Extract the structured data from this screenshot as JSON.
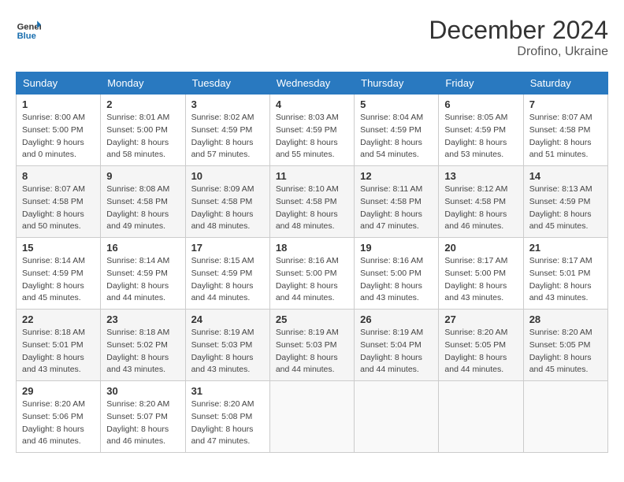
{
  "header": {
    "logo_line1": "General",
    "logo_line2": "Blue",
    "month_title": "December 2024",
    "location": "Drofino, Ukraine"
  },
  "calendar": {
    "days_of_week": [
      "Sunday",
      "Monday",
      "Tuesday",
      "Wednesday",
      "Thursday",
      "Friday",
      "Saturday"
    ],
    "weeks": [
      [
        {
          "day": "1",
          "info": "Sunrise: 8:00 AM\nSunset: 5:00 PM\nDaylight: 9 hours\nand 0 minutes."
        },
        {
          "day": "2",
          "info": "Sunrise: 8:01 AM\nSunset: 5:00 PM\nDaylight: 8 hours\nand 58 minutes."
        },
        {
          "day": "3",
          "info": "Sunrise: 8:02 AM\nSunset: 4:59 PM\nDaylight: 8 hours\nand 57 minutes."
        },
        {
          "day": "4",
          "info": "Sunrise: 8:03 AM\nSunset: 4:59 PM\nDaylight: 8 hours\nand 55 minutes."
        },
        {
          "day": "5",
          "info": "Sunrise: 8:04 AM\nSunset: 4:59 PM\nDaylight: 8 hours\nand 54 minutes."
        },
        {
          "day": "6",
          "info": "Sunrise: 8:05 AM\nSunset: 4:59 PM\nDaylight: 8 hours\nand 53 minutes."
        },
        {
          "day": "7",
          "info": "Sunrise: 8:07 AM\nSunset: 4:58 PM\nDaylight: 8 hours\nand 51 minutes."
        }
      ],
      [
        {
          "day": "8",
          "info": "Sunrise: 8:07 AM\nSunset: 4:58 PM\nDaylight: 8 hours\nand 50 minutes."
        },
        {
          "day": "9",
          "info": "Sunrise: 8:08 AM\nSunset: 4:58 PM\nDaylight: 8 hours\nand 49 minutes."
        },
        {
          "day": "10",
          "info": "Sunrise: 8:09 AM\nSunset: 4:58 PM\nDaylight: 8 hours\nand 48 minutes."
        },
        {
          "day": "11",
          "info": "Sunrise: 8:10 AM\nSunset: 4:58 PM\nDaylight: 8 hours\nand 48 minutes."
        },
        {
          "day": "12",
          "info": "Sunrise: 8:11 AM\nSunset: 4:58 PM\nDaylight: 8 hours\nand 47 minutes."
        },
        {
          "day": "13",
          "info": "Sunrise: 8:12 AM\nSunset: 4:58 PM\nDaylight: 8 hours\nand 46 minutes."
        },
        {
          "day": "14",
          "info": "Sunrise: 8:13 AM\nSunset: 4:59 PM\nDaylight: 8 hours\nand 45 minutes."
        }
      ],
      [
        {
          "day": "15",
          "info": "Sunrise: 8:14 AM\nSunset: 4:59 PM\nDaylight: 8 hours\nand 45 minutes."
        },
        {
          "day": "16",
          "info": "Sunrise: 8:14 AM\nSunset: 4:59 PM\nDaylight: 8 hours\nand 44 minutes."
        },
        {
          "day": "17",
          "info": "Sunrise: 8:15 AM\nSunset: 4:59 PM\nDaylight: 8 hours\nand 44 minutes."
        },
        {
          "day": "18",
          "info": "Sunrise: 8:16 AM\nSunset: 5:00 PM\nDaylight: 8 hours\nand 44 minutes."
        },
        {
          "day": "19",
          "info": "Sunrise: 8:16 AM\nSunset: 5:00 PM\nDaylight: 8 hours\nand 43 minutes."
        },
        {
          "day": "20",
          "info": "Sunrise: 8:17 AM\nSunset: 5:00 PM\nDaylight: 8 hours\nand 43 minutes."
        },
        {
          "day": "21",
          "info": "Sunrise: 8:17 AM\nSunset: 5:01 PM\nDaylight: 8 hours\nand 43 minutes."
        }
      ],
      [
        {
          "day": "22",
          "info": "Sunrise: 8:18 AM\nSunset: 5:01 PM\nDaylight: 8 hours\nand 43 minutes."
        },
        {
          "day": "23",
          "info": "Sunrise: 8:18 AM\nSunset: 5:02 PM\nDaylight: 8 hours\nand 43 minutes."
        },
        {
          "day": "24",
          "info": "Sunrise: 8:19 AM\nSunset: 5:03 PM\nDaylight: 8 hours\nand 43 minutes."
        },
        {
          "day": "25",
          "info": "Sunrise: 8:19 AM\nSunset: 5:03 PM\nDaylight: 8 hours\nand 44 minutes."
        },
        {
          "day": "26",
          "info": "Sunrise: 8:19 AM\nSunset: 5:04 PM\nDaylight: 8 hours\nand 44 minutes."
        },
        {
          "day": "27",
          "info": "Sunrise: 8:20 AM\nSunset: 5:05 PM\nDaylight: 8 hours\nand 44 minutes."
        },
        {
          "day": "28",
          "info": "Sunrise: 8:20 AM\nSunset: 5:05 PM\nDaylight: 8 hours\nand 45 minutes."
        }
      ],
      [
        {
          "day": "29",
          "info": "Sunrise: 8:20 AM\nSunset: 5:06 PM\nDaylight: 8 hours\nand 46 minutes."
        },
        {
          "day": "30",
          "info": "Sunrise: 8:20 AM\nSunset: 5:07 PM\nDaylight: 8 hours\nand 46 minutes."
        },
        {
          "day": "31",
          "info": "Sunrise: 8:20 AM\nSunset: 5:08 PM\nDaylight: 8 hours\nand 47 minutes."
        },
        {
          "day": "",
          "info": ""
        },
        {
          "day": "",
          "info": ""
        },
        {
          "day": "",
          "info": ""
        },
        {
          "day": "",
          "info": ""
        }
      ]
    ]
  }
}
